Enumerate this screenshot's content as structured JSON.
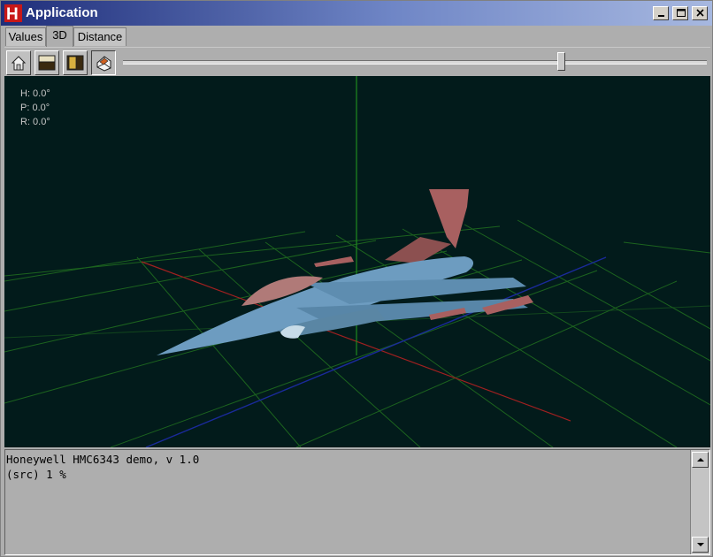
{
  "window": {
    "title": "Application",
    "logo_letter": "H",
    "controls": [
      "minimize",
      "maximize",
      "close"
    ]
  },
  "tabs": [
    {
      "label": "Values",
      "active": false
    },
    {
      "label": "3D",
      "active": true
    },
    {
      "label": "Distance",
      "active": false
    }
  ],
  "toolbar": {
    "buttons": [
      {
        "icon": "home-view-icon",
        "pressed": false
      },
      {
        "icon": "top-view-icon",
        "pressed": false
      },
      {
        "icon": "side-view-icon",
        "pressed": false
      },
      {
        "icon": "perspective-view-icon",
        "pressed": true
      }
    ],
    "zoom_slider_level": 0.75
  },
  "viewport": {
    "heading": "H: 0.0°",
    "pitch": "P: 0.0°",
    "roll": "R: 0.0°",
    "background_color": "#021b1b",
    "grid_color": "#1f6b1f",
    "x_axis_color": "#a02020",
    "z_axis_color": "#1a2a9a",
    "aircraft_color": "#5e8db0",
    "accent_color": "#b86b6b"
  },
  "console": {
    "lines": [
      "Honeywell HMC6343 demo, v 1.0",
      "(src) 1 %"
    ]
  }
}
